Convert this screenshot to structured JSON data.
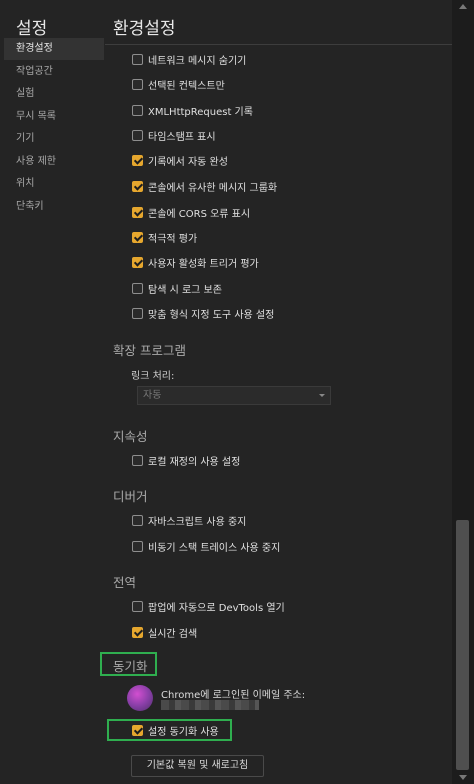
{
  "sidebar": {
    "title": "설정",
    "items": [
      {
        "label": "환경설정",
        "active": true
      },
      {
        "label": "작업공간"
      },
      {
        "label": "실험"
      },
      {
        "label": "무시 목록"
      },
      {
        "label": "기기"
      },
      {
        "label": "사용 제한"
      },
      {
        "label": "위치"
      },
      {
        "label": "단축키"
      }
    ]
  },
  "main": {
    "title": "환경설정",
    "console_options": [
      {
        "label": "네트워크 메시지 숨기기",
        "checked": false
      },
      {
        "label": "선택된 컨텍스트만",
        "checked": false
      },
      {
        "label": "XMLHttpRequest 기록",
        "checked": false
      },
      {
        "label": "타임스탬프 표시",
        "checked": false
      },
      {
        "label": "기록에서 자동 완성",
        "checked": true
      },
      {
        "label": "콘솔에서 유사한 메시지 그룹화",
        "checked": true
      },
      {
        "label": "콘솔에 CORS 오류 표시",
        "checked": true
      },
      {
        "label": "적극적 평가",
        "checked": true
      },
      {
        "label": "사용자 활성화 트리거 평가",
        "checked": true
      },
      {
        "label": "탐색 시 로그 보존",
        "checked": false
      },
      {
        "label": "맞춤 형식 지정 도구 사용 설정",
        "checked": false
      }
    ],
    "extensions": {
      "title": "확장 프로그램",
      "link_label": "링크 처리:",
      "link_value": "자동"
    },
    "persistence": {
      "title": "지속성",
      "options": [
        {
          "label": "로컬 재정의 사용 설정",
          "checked": false
        }
      ]
    },
    "debugger": {
      "title": "디버거",
      "options": [
        {
          "label": "자바스크립트 사용 중지",
          "checked": false
        },
        {
          "label": "비동기 스택 트레이스 사용 중지",
          "checked": false
        }
      ]
    },
    "global": {
      "title": "전역",
      "options": [
        {
          "label": "팝업에 자동으로 DevTools 열기",
          "checked": false
        },
        {
          "label": "실시간 검색",
          "checked": true
        }
      ]
    },
    "sync": {
      "title": "동기화",
      "email_label": "Chrome에 로그인된 이메일 주소:",
      "option": {
        "label": "설정 동기화 사용",
        "checked": true
      }
    },
    "reset_button": "기본값 복원 및 새로고침"
  },
  "colors": {
    "accent": "#e6a72e",
    "highlight_box": "#2fae4f",
    "background": "#242424"
  }
}
